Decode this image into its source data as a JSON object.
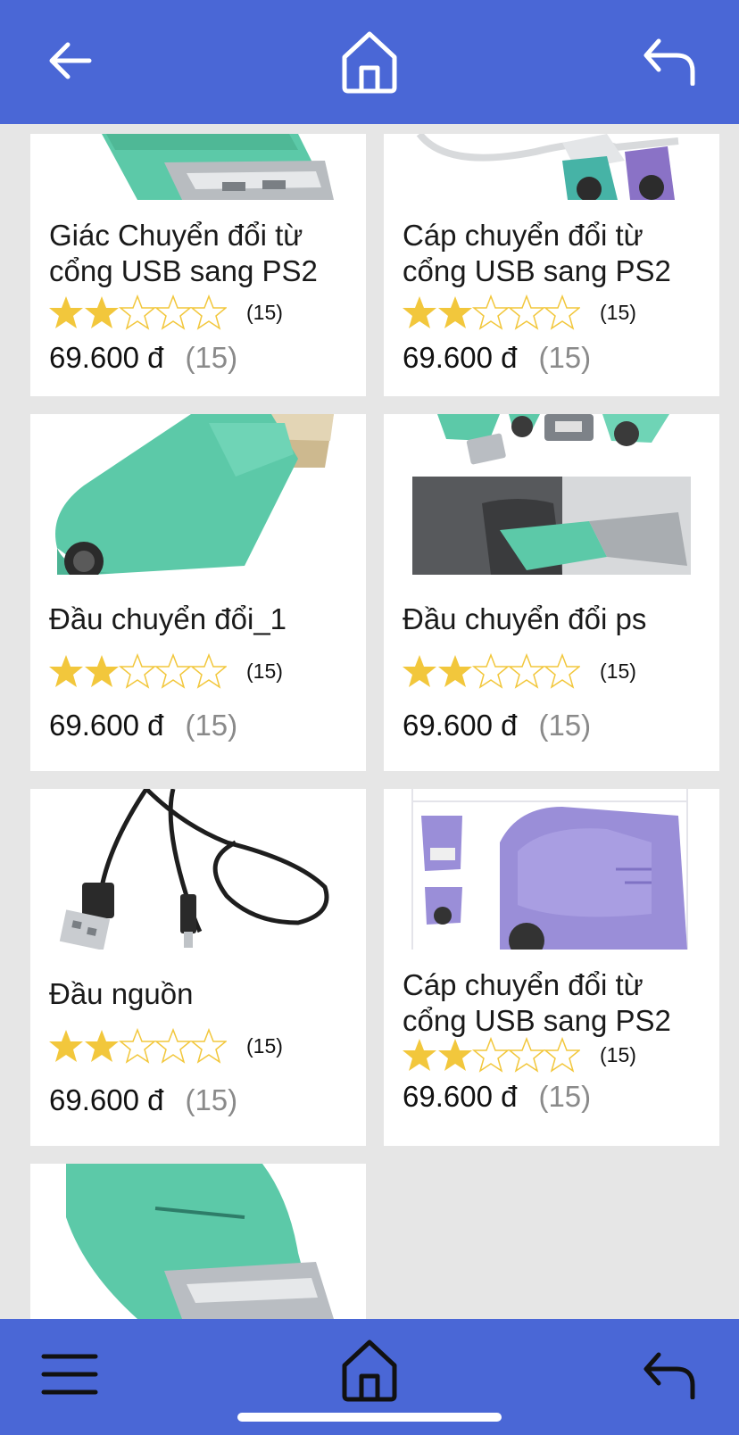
{
  "header": {
    "back_icon": "arrow-left-icon",
    "home_icon": "home-icon",
    "return_icon": "return-icon"
  },
  "products": [
    {
      "title": "Giác Chuyển đổi từ cổng USB sang PS2",
      "rating": 2.5,
      "rating_count": "(15)",
      "price": "69.600 đ",
      "price_count": "(15)"
    },
    {
      "title": "Cáp chuyển đổi từ cổng USB sang PS2",
      "rating": 2.5,
      "rating_count": "(15)",
      "price": "69.600 đ",
      "price_count": "(15)"
    },
    {
      "title": "Đầu chuyển đổi_1",
      "rating": 2.5,
      "rating_count": "(15)",
      "price": "69.600 đ",
      "price_count": "(15)"
    },
    {
      "title": "Đầu chuyển đổi ps",
      "rating": 2.5,
      "rating_count": "(15)",
      "price": "69.600 đ",
      "price_count": "(15)"
    },
    {
      "title": "Đầu nguồn",
      "rating": 2.5,
      "rating_count": "(15)",
      "price": "69.600 đ",
      "price_count": "(15)"
    },
    {
      "title": "Cáp chuyển đổi từ cổng USB sang PS2",
      "rating": 2.5,
      "rating_count": "(15)",
      "price": "69.600 đ",
      "price_count": "(15)"
    }
  ],
  "footer": {
    "menu_icon": "hamburger-menu-icon",
    "home_icon": "home-icon",
    "return_icon": "return-icon"
  },
  "colors": {
    "bar": "#4a67d6",
    "star": "#f2c73c",
    "adapter_green": "#5cc9a8",
    "adapter_purple": "#9a8ed8"
  }
}
